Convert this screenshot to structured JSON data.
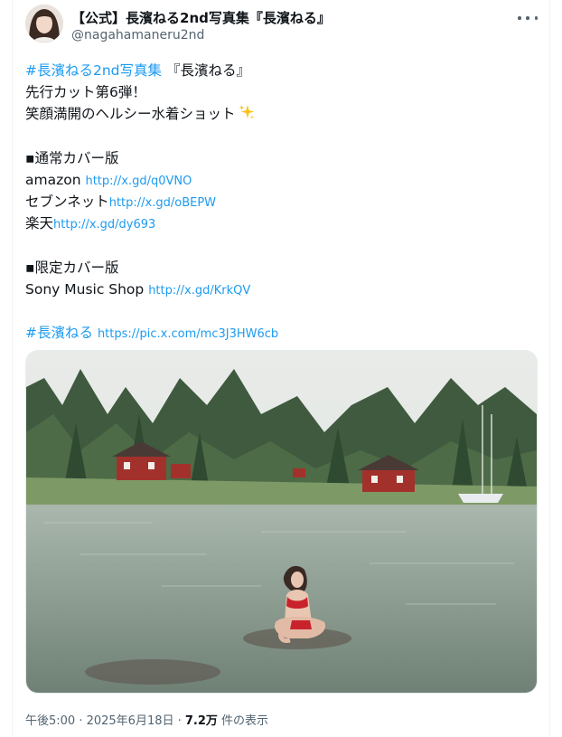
{
  "account": {
    "display_name": "【公式】長濱ねる2nd写真集『長濱ねる』",
    "handle": "@nagahamaneru2nd"
  },
  "tweet": {
    "line1_hashtag": "#長濱ねる2nd写真集",
    "line1_rest": " 『長濱ねる』",
    "line2": "先行カット第6弾！",
    "line3": "笑顔満開のヘルシー水着ショット",
    "section1_header": "▪通常カバー版",
    "amazon_label": "amazon ",
    "amazon_link": "http://x.gd/q0VNO",
    "seven_label": "セブンネット",
    "seven_link": "http://x.gd/oBEPW",
    "rakuten_label": "楽天",
    "rakuten_link": "http://x.gd/dy693",
    "section2_header": "▪限定カバー版",
    "sony_label": "Sony Music Shop ",
    "sony_link": "http://x.gd/KrkQV",
    "hashtag2": "#長濱ねる",
    "pic_link": "https://pic.x.com/mc3J3HW6cb"
  },
  "meta": {
    "time": "午後5:00 · 2025年6月18日 · ",
    "views_count": "7.2万",
    "views_label": " 件の表示"
  },
  "icons": {
    "more": "more-horizontal-icon",
    "sparkle": "sparkles-emoji"
  },
  "colors": {
    "link": "#1d9bf0",
    "text": "#0f1419",
    "secondary": "#536471"
  }
}
